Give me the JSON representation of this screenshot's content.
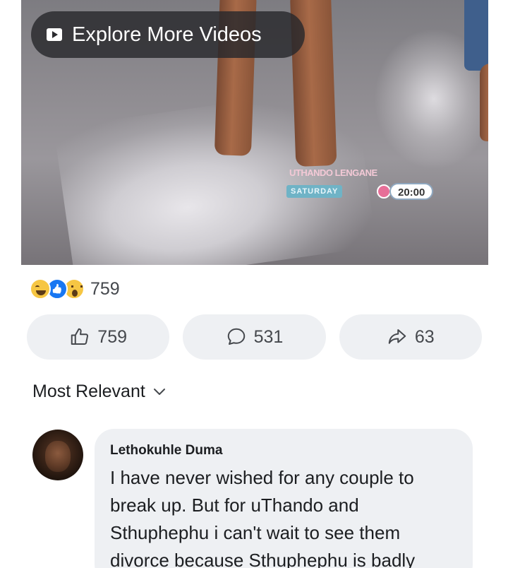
{
  "video": {
    "explore_label": "Explore More Videos",
    "overlay": {
      "brand": "UTHANDO LENGANE",
      "day": "SATURDAY",
      "time": "20:00"
    }
  },
  "reactions": {
    "types": [
      "haha",
      "like",
      "wow"
    ],
    "count": "759"
  },
  "actions": {
    "like_count": "759",
    "comment_count": "531",
    "share_count": "63"
  },
  "sort": {
    "label": "Most Relevant"
  },
  "comment": {
    "author": "Lethokuhle Duma",
    "text": "I have never wished for any couple to break up. But for uThando and Sthuphephu i can't wait to see them divorce because Sthuphephu is badly"
  },
  "colors": {
    "accent_blue": "#1877f2",
    "button_bg": "#eef0f3",
    "text_muted": "#45484d"
  }
}
